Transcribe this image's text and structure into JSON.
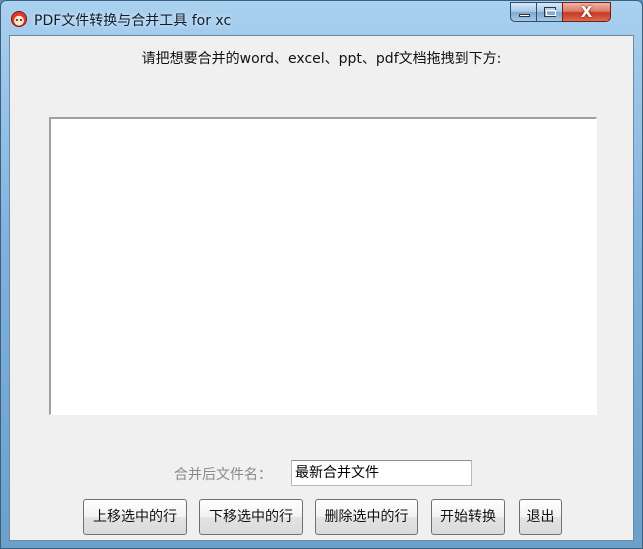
{
  "window": {
    "title": "PDF文件转换与合并工具 for xc",
    "controls": {
      "close": "X"
    }
  },
  "main": {
    "instruction": "请把想要合并的word、excel、ppt、pdf文档拖拽到下方:",
    "file_list_items": [],
    "output_label": "合并后文件名：",
    "output_value": "最新合并文件"
  },
  "buttons": {
    "move_up": "上移选中的行",
    "move_down": "下移选中的行",
    "delete": "删除选中的行",
    "start": "开始转换",
    "exit": "退出"
  },
  "icons": {
    "app": "app-face-icon",
    "minimize": "minimize-icon",
    "maximize": "maximize-icon",
    "close": "close-icon"
  }
}
